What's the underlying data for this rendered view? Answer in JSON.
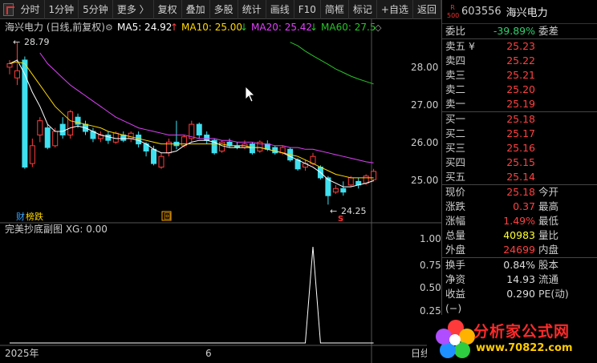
{
  "toolbar": {
    "items": [
      {
        "label": "分时"
      },
      {
        "label": "1分钟"
      },
      {
        "label": "5分钟"
      },
      {
        "label": "更多 〉"
      },
      {
        "label": "复权"
      },
      {
        "label": "叠加"
      },
      {
        "label": "多股"
      },
      {
        "label": "统计"
      },
      {
        "label": "画线"
      },
      {
        "label": "F10"
      },
      {
        "label": "简框"
      },
      {
        "label": "标记"
      },
      {
        "label": "+自选"
      },
      {
        "label": "返回"
      }
    ]
  },
  "main_chart": {
    "title": "海兴电力 (日线,前复权)",
    "ma": [
      {
        "label": "MA5: 24.92",
        "arrow": "↑",
        "color": "#ffffff"
      },
      {
        "label": "MA10: 25.00",
        "arrow": "↓",
        "color": "#ffd800"
      },
      {
        "label": "MA20: 25.42",
        "arrow": "↓",
        "color": "#e040fb"
      },
      {
        "label": "MA60: 27.5",
        "arrow": "◇",
        "color": "#29c229"
      }
    ],
    "price_axis": [
      "28.00",
      "27.00",
      "26.00",
      "25.00"
    ],
    "high_marker": "28.79",
    "low_marker": "24.25",
    "badge_left": "财",
    "badge_text": "榜跌",
    "badge_box": "回",
    "marker_s": "S"
  },
  "indicator": {
    "title": "完美抄底副图  XG: 0.00",
    "axis": [
      "1.00",
      "0.75",
      "0.50",
      "0.25"
    ]
  },
  "time_axis": {
    "labels": [
      "2025年",
      "6"
    ],
    "right_label": "日线"
  },
  "quote": {
    "code": "603556",
    "name": "海兴电力",
    "tag_top": "R",
    "tag_bottom": "500",
    "webi_label": "委比",
    "webi_value": "-39.89%",
    "webi_right": "委差",
    "sell": [
      {
        "label": "卖五 ¥",
        "price": "25.23"
      },
      {
        "label": "卖四",
        "price": "25.22"
      },
      {
        "label": "卖三",
        "price": "25.21"
      },
      {
        "label": "卖二",
        "price": "25.20"
      },
      {
        "label": "卖一",
        "price": "25.19"
      }
    ],
    "buy": [
      {
        "label": "买一",
        "price": "25.18"
      },
      {
        "label": "买二",
        "price": "25.17"
      },
      {
        "label": "买三",
        "price": "25.16"
      },
      {
        "label": "买四",
        "price": "25.15"
      },
      {
        "label": "买五",
        "price": "25.14"
      }
    ],
    "stats": [
      {
        "label": "现价",
        "value": "25.18",
        "cls": "red",
        "right": "今开"
      },
      {
        "label": "涨跌",
        "value": "0.37",
        "cls": "red",
        "right": "最高"
      },
      {
        "label": "涨幅",
        "value": "1.49%",
        "cls": "red",
        "right": "最低"
      },
      {
        "label": "总量",
        "value": "40983",
        "cls": "yellow",
        "right": "量比"
      },
      {
        "label": "外盘",
        "value": "24699",
        "cls": "red",
        "right": "内盘"
      }
    ],
    "stats2": [
      {
        "label": "换手",
        "value": "0.84%",
        "right": "股本"
      },
      {
        "label": "净资",
        "value": "14.93",
        "right": "流通"
      },
      {
        "label": "收益(−)",
        "value": "0.290",
        "right": "PE(动)"
      }
    ]
  },
  "logo": {
    "title": "分析家公式网",
    "url": "www.70822.com"
  },
  "chart_data": {
    "type": "candlestick",
    "ylim": [
      24.1,
      28.95
    ],
    "candles": [
      [
        28.1,
        28.2,
        27.9,
        28.3
      ],
      [
        27.8,
        28.0,
        27.6,
        28.79
      ],
      [
        28.3,
        25.3,
        25.25,
        28.4
      ],
      [
        25.4,
        25.9,
        25.3,
        26.1
      ],
      [
        26.2,
        26.6,
        26.0,
        26.7
      ],
      [
        26.4,
        25.85,
        25.8,
        26.5
      ],
      [
        25.9,
        26.3,
        25.85,
        26.4
      ],
      [
        26.5,
        26.2,
        26.1,
        26.7
      ],
      [
        26.2,
        26.85,
        26.1,
        26.9
      ],
      [
        26.7,
        26.5,
        26.4,
        26.8
      ],
      [
        26.5,
        26.3,
        26.2,
        26.6
      ],
      [
        26.3,
        26.1,
        26.0,
        26.4
      ],
      [
        26.1,
        26.2,
        26.0,
        26.3
      ],
      [
        26.2,
        26.05,
        25.95,
        26.3
      ],
      [
        26.0,
        26.25,
        25.95,
        26.3
      ],
      [
        26.2,
        26.05,
        26.0,
        26.3
      ],
      [
        26.1,
        26.25,
        26.0,
        26.3
      ],
      [
        26.2,
        25.95,
        25.85,
        26.3
      ],
      [
        25.95,
        25.75,
        25.6,
        26.0
      ],
      [
        25.8,
        25.4,
        25.35,
        25.9
      ],
      [
        25.3,
        25.6,
        25.25,
        25.7
      ],
      [
        25.7,
        26.0,
        25.6,
        26.1
      ],
      [
        26.0,
        25.9,
        25.8,
        26.6
      ],
      [
        25.9,
        26.15,
        25.85,
        26.2
      ],
      [
        26.1,
        26.5,
        26.0,
        26.6
      ],
      [
        26.5,
        26.2,
        26.1,
        26.55
      ],
      [
        26.2,
        26.05,
        25.95,
        26.3
      ],
      [
        26.05,
        25.7,
        25.65,
        26.1
      ],
      [
        25.75,
        26.0,
        25.7,
        26.05
      ],
      [
        26.0,
        25.9,
        25.85,
        26.1
      ],
      [
        25.9,
        25.85,
        25.8,
        26.0
      ],
      [
        25.85,
        25.95,
        25.8,
        26.05
      ],
      [
        25.95,
        25.7,
        25.65,
        26.0
      ],
      [
        25.75,
        26.0,
        25.7,
        26.05
      ],
      [
        25.95,
        25.8,
        25.75,
        26.05
      ],
      [
        25.85,
        25.7,
        25.65,
        25.9
      ],
      [
        25.7,
        25.85,
        25.65,
        25.9
      ],
      [
        25.8,
        25.5,
        25.45,
        25.85
      ],
      [
        25.5,
        25.25,
        25.2,
        25.55
      ],
      [
        25.3,
        25.4,
        25.2,
        25.5
      ],
      [
        25.4,
        25.6,
        25.35,
        25.7
      ],
      [
        25.3,
        25.0,
        24.95,
        25.35
      ],
      [
        25.0,
        24.5,
        24.25,
        25.05
      ],
      [
        24.6,
        24.7,
        24.55,
        24.8
      ],
      [
        24.7,
        24.6,
        24.5,
        24.9
      ],
      [
        24.8,
        25.0,
        24.75,
        25.05
      ],
      [
        24.9,
        24.8,
        24.7,
        25.0
      ],
      [
        24.85,
        25.05,
        24.8,
        25.1
      ],
      [
        24.95,
        25.18,
        24.9,
        25.25
      ]
    ],
    "ma5": [
      28.2,
      28.3,
      27.9,
      27.4,
      27.0,
      26.5,
      26.3,
      26.3,
      26.4,
      26.45,
      26.4,
      26.3,
      26.2,
      26.15,
      26.1,
      26.1,
      26.1,
      26.05,
      25.95,
      25.8,
      25.7,
      25.7,
      25.75,
      25.9,
      26.0,
      26.05,
      26.05,
      26.0,
      25.9,
      25.85,
      25.85,
      25.85,
      25.85,
      25.85,
      25.8,
      25.75,
      25.7,
      25.6,
      25.5,
      25.4,
      25.3,
      25.15,
      24.95,
      24.85,
      24.75,
      24.75,
      24.8,
      24.85,
      24.92
    ],
    "ma10": [
      28.2,
      28.25,
      28.2,
      27.9,
      27.6,
      27.3,
      27.0,
      26.8,
      26.6,
      26.55,
      26.5,
      26.45,
      26.4,
      26.3,
      26.25,
      26.2,
      26.15,
      26.1,
      26.05,
      26.0,
      25.95,
      25.95,
      25.95,
      25.95,
      25.95,
      25.95,
      25.95,
      25.95,
      25.95,
      25.9,
      25.9,
      25.9,
      25.85,
      25.85,
      25.8,
      25.75,
      25.7,
      25.65,
      25.6,
      25.5,
      25.4,
      25.3,
      25.2,
      25.1,
      25.05,
      25.0,
      25.0,
      25.0,
      25.0
    ],
    "ma20": [
      null,
      null,
      null,
      null,
      28.5,
      28.2,
      28.0,
      27.8,
      27.6,
      27.45,
      27.3,
      27.15,
      27.0,
      26.85,
      26.7,
      26.6,
      26.5,
      26.4,
      26.35,
      26.3,
      26.25,
      26.2,
      26.2,
      26.2,
      26.15,
      26.1,
      26.1,
      26.1,
      26.05,
      26.05,
      26.0,
      26.0,
      26.0,
      25.95,
      25.95,
      25.9,
      25.9,
      25.85,
      25.85,
      25.8,
      25.8,
      25.75,
      25.7,
      25.65,
      25.6,
      25.55,
      25.5,
      25.45,
      25.42
    ],
    "ma60": [
      null,
      null,
      null,
      null,
      null,
      null,
      null,
      null,
      null,
      null,
      null,
      null,
      null,
      null,
      null,
      null,
      null,
      null,
      null,
      null,
      null,
      null,
      null,
      null,
      null,
      null,
      null,
      null,
      null,
      null,
      null,
      null,
      null,
      null,
      null,
      null,
      null,
      28.8,
      28.7,
      28.55,
      28.42,
      28.3,
      28.18,
      28.05,
      27.95,
      27.85,
      27.77,
      27.7,
      27.63
    ],
    "indicator_series": [
      0,
      0,
      0,
      0,
      0,
      0,
      0,
      0,
      0,
      0,
      0,
      0,
      0,
      0,
      0,
      0,
      0,
      0,
      0,
      0,
      0,
      0,
      0,
      0,
      0,
      0,
      0,
      0,
      0,
      0,
      0,
      0,
      0,
      0,
      0,
      0,
      0,
      0,
      0,
      0,
      1,
      0,
      0,
      0,
      0,
      0,
      0,
      0,
      0
    ],
    "indicator_ylim": [
      0,
      1.1
    ]
  }
}
